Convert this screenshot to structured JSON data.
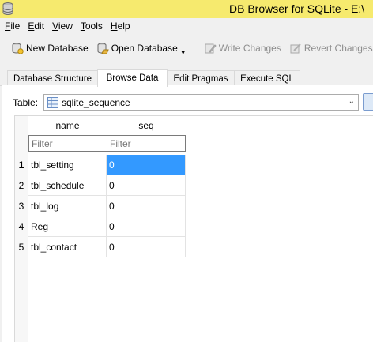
{
  "window": {
    "title": "DB Browser for SQLite - E:\\"
  },
  "menu": {
    "items": [
      {
        "accel": "F",
        "rest": "ile"
      },
      {
        "accel": "E",
        "rest": "dit"
      },
      {
        "accel": "V",
        "rest": "iew"
      },
      {
        "accel": "T",
        "rest": "ools"
      },
      {
        "accel": "H",
        "rest": "elp"
      }
    ]
  },
  "toolbar": {
    "new_database": "New Database",
    "open_database": "Open Database",
    "write_changes": "Write Changes",
    "revert_changes": "Revert Changes"
  },
  "tabs": [
    {
      "label": "Database Structure"
    },
    {
      "label": "Browse Data"
    },
    {
      "label": "Edit Pragmas"
    },
    {
      "label": "Execute SQL"
    }
  ],
  "browse": {
    "table_label_accel": "T",
    "table_label_rest": "able:",
    "selected_table": "sqlite_sequence",
    "columns": [
      {
        "header": "name",
        "filter_placeholder": "Filter"
      },
      {
        "header": "seq",
        "filter_placeholder": "Filter"
      }
    ],
    "rows": [
      {
        "num": "1",
        "name": "tbl_setting",
        "seq": "0"
      },
      {
        "num": "2",
        "name": "tbl_schedule",
        "seq": "0"
      },
      {
        "num": "3",
        "name": "tbl_log",
        "seq": "0"
      },
      {
        "num": "4",
        "name": "Reg",
        "seq": "0"
      },
      {
        "num": "5",
        "name": "tbl_contact",
        "seq": "0"
      }
    ]
  },
  "colors": {
    "titlebar": "#f6ea6e",
    "selection": "#3399ff"
  }
}
